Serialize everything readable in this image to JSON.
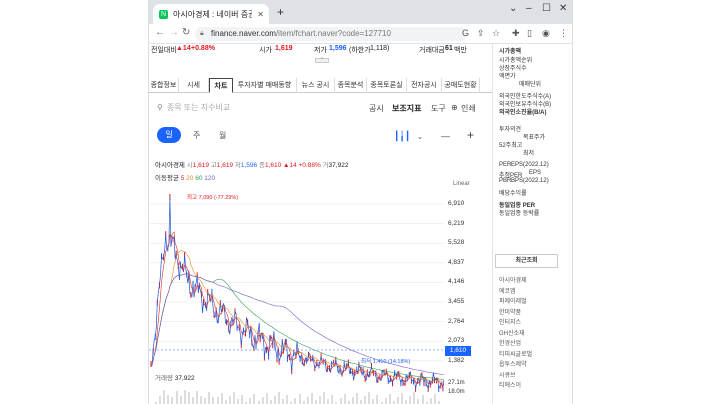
{
  "browser": {
    "tab_title": "아시아경제 : 네이버 증권",
    "favicon": "N",
    "url_host": "finance.naver.com",
    "url_path": "/item/fchart.naver?code=127710"
  },
  "stock_bar": {
    "prev_close_label": "전일대비",
    "change": "▲14",
    "change_pct": "+0.88%",
    "open_label": "시가",
    "open": "1,619",
    "low_label": "저가",
    "low": "1,596",
    "low_limit_label": "(하한가",
    "low_limit": "1,118)",
    "amount_label": "거래대금",
    "amount": "61",
    "amount_unit": "백만"
  },
  "tabs": [
    "종합정보",
    "시세",
    "차트",
    "투자자별 매매동향",
    "뉴스 공시",
    "종목분석",
    "종목토론실",
    "전자공시",
    "공매도현황"
  ],
  "active_tab": 2,
  "toolbar": {
    "search_placeholder": "종목 또는 지수비교",
    "disclosure": "공시",
    "indicators": "보조지표",
    "tools": "도구",
    "print": "인쇄"
  },
  "periods": [
    "일",
    "주",
    "월"
  ],
  "info": {
    "name": "아시아경제",
    "open_l": "시",
    "open": "1,619",
    "high_l": "고",
    "high": "1,619",
    "low_l": "저",
    "low": "1,596",
    "close_l": "종",
    "close": "1,610",
    "change": "▲14",
    "pct": "+0.88%",
    "vol_l": "거",
    "vol": "37,922"
  },
  "ma": {
    "label": "이동평균",
    "v1": "5",
    "v2": "20",
    "v3": "60",
    "v4": "120"
  },
  "scale_label": "Linear",
  "price_axis": [
    "6,910",
    "6,219",
    "5,528",
    "4,837",
    "4,146",
    "3,455",
    "2,764",
    "2,073",
    "1,382"
  ],
  "current_price": "1,610",
  "high_annotation": "최고 7,090 (-77.29%)",
  "low_annotation": "최저 1,410 (14.18%)",
  "volume": {
    "label": "거래량",
    "value": "37,922"
  },
  "volume_axis": [
    "27.1m",
    "18.0m"
  ],
  "right_panel": {
    "items": [
      "시가총액",
      "시가총액순위",
      "상장주식수",
      "액면가",
      "매매단위",
      "외국인한도주식수(A)",
      "외국인보유주식수(B)",
      "외국인소진율(B/A)",
      "투자의견",
      "목표주가",
      "52주최고",
      "최저",
      "PER",
      "EPS(2022.12)",
      "추정PER",
      "EPS",
      "PBR",
      "BPS(2022.12)",
      "배당수익률",
      "동일업종 PER",
      "동일업종 등락률"
    ],
    "recent_title": "최근조회",
    "recent": [
      "아시아경제",
      "에코앱",
      "퍼제이레벌",
      "한미약품",
      "인터지스",
      "GH신소재",
      "한경산업",
      "티피씨글로벌",
      "옵투스제약",
      "시큐브",
      "티에스이"
    ]
  },
  "colors": {
    "up": "#e4171c",
    "down": "#1b63ff",
    "ma5": "#d72b2b",
    "ma20": "#e08a2a",
    "ma60": "#2e9e52",
    "ma120": "#7b5ac9"
  }
}
